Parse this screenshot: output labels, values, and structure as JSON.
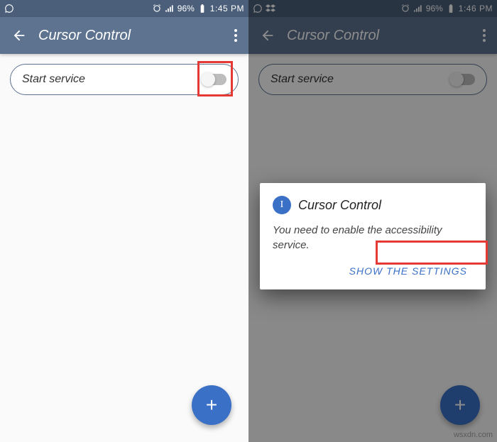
{
  "watermark": "wsxdn.com",
  "left": {
    "statusbar": {
      "battery": "96%",
      "time": "1:45 PM"
    },
    "appbar": {
      "title": "Cursor Control"
    },
    "card": {
      "label": "Start service"
    },
    "fab": "+"
  },
  "right": {
    "statusbar": {
      "battery": "96%",
      "time": "1:46 PM"
    },
    "appbar": {
      "title": "Cursor Control"
    },
    "card": {
      "label": "Start service"
    },
    "dialog": {
      "icon_letter": "I",
      "title": "Cursor Control",
      "body": "You need to enable the accessibility service.",
      "action": "SHOW THE SETTINGS"
    },
    "fab": "+"
  }
}
